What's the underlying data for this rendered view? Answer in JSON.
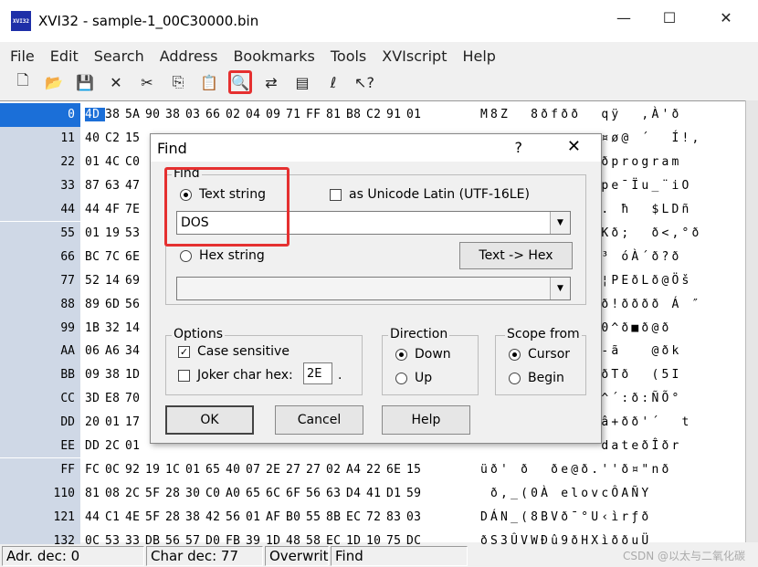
{
  "window": {
    "title": "XVI32 - sample-1_00C30000.bin",
    "icon_label": "XVI32",
    "controls": [
      "—",
      "☐",
      "✕"
    ]
  },
  "menu": [
    "File",
    "Edit",
    "Search",
    "Address",
    "Bookmarks",
    "Tools",
    "XVIscript",
    "Help"
  ],
  "toolbar": [
    {
      "name": "new-icon",
      "glyph": "🗋"
    },
    {
      "name": "open-icon",
      "glyph": "📂"
    },
    {
      "name": "save-icon",
      "glyph": "💾"
    },
    {
      "name": "delete-icon",
      "glyph": "✕"
    },
    {
      "name": "cut-icon",
      "glyph": "✂"
    },
    {
      "name": "copy-icon",
      "glyph": "⎘"
    },
    {
      "name": "paste-icon",
      "glyph": "📋"
    },
    {
      "name": "find-icon",
      "glyph": "🔍",
      "highlighted": true
    },
    {
      "name": "replace-icon",
      "glyph": "⇄"
    },
    {
      "name": "properties-icon",
      "glyph": "▤"
    },
    {
      "name": "script-icon",
      "glyph": "ℓ"
    },
    {
      "name": "help-pointer-icon",
      "glyph": "↖?"
    }
  ],
  "hex": {
    "rows": [
      {
        "addr": "0",
        "bytes": [
          "4D",
          "38",
          "5A",
          "90",
          "38",
          "03",
          "66",
          "02",
          "04",
          "09",
          "71",
          "FF",
          "81",
          "B8",
          "C2",
          "91",
          "01"
        ],
        "text": "M8Z  8ðfðð  qÿ  ,À'ð",
        "selected": true
      },
      {
        "addr": "11",
        "bytes": [
          "40",
          "C2",
          "15",
          "",
          "",
          "",
          "",
          "",
          "",
          "",
          "",
          "",
          "",
          "",
          "",
          "",
          ""
        ],
        "text": "            ¤ø@ ´  Í!,"
      },
      {
        "addr": "22",
        "bytes": [
          "01",
          "4C",
          "C0",
          "",
          "",
          "",
          "",
          "",
          "",
          "",
          "",
          "",
          "",
          "",
          "",
          "",
          ""
        ],
        "text": "            ðprogram"
      },
      {
        "addr": "33",
        "bytes": [
          "87",
          "63",
          "47",
          "",
          "",
          "",
          "",
          "",
          "",
          "",
          "",
          "",
          "",
          "",
          "",
          "",
          ""
        ],
        "text": "            pe¯Ïu_¨iO"
      },
      {
        "addr": "44",
        "bytes": [
          "44",
          "4F",
          "7E",
          "",
          "",
          "",
          "",
          "",
          "",
          "",
          "",
          "",
          "",
          "",
          "",
          "",
          ""
        ],
        "text": "            . ħ  $LDñ"
      },
      {
        "addr": "55",
        "bytes": [
          "01",
          "19",
          "53",
          "",
          "",
          "",
          "",
          "",
          "",
          "",
          "",
          "",
          "",
          "",
          "",
          "",
          ""
        ],
        "text": "            Kð;  ð<,°ð"
      },
      {
        "addr": "66",
        "bytes": [
          "BC",
          "7C",
          "6E",
          "",
          "",
          "",
          "",
          "",
          "",
          "",
          "",
          "",
          "",
          "",
          "",
          "",
          ""
        ],
        "text": "            ³ óÀ´ð?ð"
      },
      {
        "addr": "77",
        "bytes": [
          "52",
          "14",
          "69",
          "",
          "",
          "",
          "",
          "",
          "",
          "",
          "",
          "",
          "",
          "",
          "",
          "",
          ""
        ],
        "text": "            ¦PEðLð@Öš"
      },
      {
        "addr": "88",
        "bytes": [
          "89",
          "6D",
          "56",
          "",
          "",
          "",
          "",
          "",
          "",
          "",
          "",
          "",
          "",
          "",
          "",
          "",
          ""
        ],
        "text": "            ð!ðððð Á ″"
      },
      {
        "addr": "99",
        "bytes": [
          "1B",
          "32",
          "14",
          "",
          "",
          "",
          "",
          "",
          "",
          "",
          "",
          "",
          "",
          "",
          "",
          "",
          ""
        ],
        "text": "            0^ð■ð@ð"
      },
      {
        "addr": "AA",
        "bytes": [
          "06",
          "A6",
          "34",
          "",
          "",
          "",
          "",
          "",
          "",
          "",
          "",
          "",
          "",
          "",
          "",
          "",
          ""
        ],
        "text": "            -ã   @ðk"
      },
      {
        "addr": "BB",
        "bytes": [
          "09",
          "38",
          "1D",
          "",
          "",
          "",
          "",
          "",
          "",
          "",
          "",
          "",
          "",
          "",
          "",
          "",
          ""
        ],
        "text": "            ðTð  (5I"
      },
      {
        "addr": "CC",
        "bytes": [
          "3D",
          "E8",
          "70",
          "",
          "",
          "",
          "",
          "",
          "",
          "",
          "",
          "",
          "",
          "",
          "",
          "",
          ""
        ],
        "text": "            ^´:ð:ÑÕ°"
      },
      {
        "addr": "DD",
        "bytes": [
          "20",
          "01",
          "17",
          "",
          "",
          "",
          "",
          "",
          "",
          "",
          "",
          "",
          "",
          "",
          "",
          "",
          ""
        ],
        "text": "            â+ðð'´  t"
      },
      {
        "addr": "EE",
        "bytes": [
          "DD",
          "2C",
          "01",
          "",
          "",
          "",
          "",
          "",
          "",
          "",
          "",
          "",
          "",
          "",
          "",
          "",
          ""
        ],
        "text": "            dateðÎðr"
      },
      {
        "addr": "FF",
        "bytes": [
          "FC",
          "0C",
          "92",
          "19",
          "1C",
          "01",
          "65",
          "40",
          "07",
          "2E",
          "27",
          "27",
          "02",
          "A4",
          "22",
          "6E",
          "15"
        ],
        "text": "üð' ð  ðe@ð.''ð¤\"nð"
      },
      {
        "addr": "110",
        "bytes": [
          "81",
          "08",
          "2C",
          "5F",
          "28",
          "30",
          "C0",
          "A0",
          "65",
          "6C",
          "6F",
          "56",
          "63",
          "D4",
          "41",
          "D1",
          "59"
        ],
        "text": " ð,_(0À elovcÔAÑY"
      },
      {
        "addr": "121",
        "bytes": [
          "44",
          "C1",
          "4E",
          "5F",
          "28",
          "38",
          "42",
          "56",
          "01",
          "AF",
          "B0",
          "55",
          "8B",
          "EC",
          "72",
          "83",
          "03"
        ],
        "text": "DÁN_(8BVð¯°U‹ìrƒð"
      },
      {
        "addr": "132",
        "bytes": [
          "0C",
          "53",
          "33",
          "DB",
          "56",
          "57",
          "D0",
          "FB",
          "39",
          "1D",
          "48",
          "58",
          "EC",
          "1D",
          "10",
          "75",
          "DC"
        ],
        "text": "ðS3ÛVWÐû9ðHXìððuÜ"
      }
    ]
  },
  "status": {
    "addr_dec": "Adr. dec: 0",
    "char_dec": "Char dec: 77",
    "mode": "Overwrit",
    "action": "Find"
  },
  "watermark": "CSDN @以太与二氧化碳",
  "dialog": {
    "title": "Find",
    "help_glyph": "?",
    "close_glyph": "✕",
    "find_group": "Find",
    "text_string_label": "Text string",
    "unicode_label": "as Unicode Latin (UTF-16LE)",
    "text_value": "DOS",
    "hex_string_label": "Hex string",
    "text_to_hex_label": "Text -> Hex",
    "hex_value": "",
    "options_group": "Options",
    "case_sensitive_label": "Case sensitive",
    "joker_label": "Joker char hex:",
    "joker_value": "2E",
    "joker_suffix": ".",
    "direction_group": "Direction",
    "down_label": "Down",
    "up_label": "Up",
    "scope_group": "Scope from",
    "cursor_label": "Cursor",
    "begin_label": "Begin",
    "ok_label": "OK",
    "cancel_label": "Cancel",
    "help_label": "Help"
  }
}
